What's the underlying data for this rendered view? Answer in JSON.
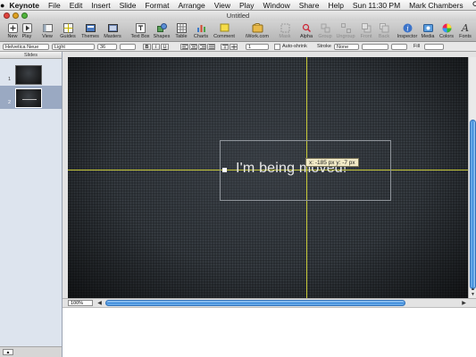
{
  "menubar": {
    "apple": "",
    "app_name": "Keynote",
    "items": [
      "File",
      "Edit",
      "Insert",
      "Slide",
      "Format",
      "Arrange",
      "View",
      "Play",
      "Window",
      "Share",
      "Help"
    ],
    "clock": "Sun 11:30 PM",
    "user": "Mark Chambers"
  },
  "window": {
    "title": "Untitled"
  },
  "toolbar": {
    "items": [
      {
        "label": "New",
        "icon": "plus-icon"
      },
      {
        "label": "Play",
        "icon": "play-icon"
      },
      {
        "label": "View",
        "icon": "view-icon"
      },
      {
        "label": "Guides",
        "icon": "guides-icon"
      },
      {
        "label": "Themes",
        "icon": "themes-icon"
      },
      {
        "label": "Masters",
        "icon": "masters-icon"
      },
      {
        "label": "Text Box",
        "icon": "textbox-icon"
      },
      {
        "label": "Shapes",
        "icon": "shapes-icon"
      },
      {
        "label": "Table",
        "icon": "table-icon"
      },
      {
        "label": "Charts",
        "icon": "charts-icon"
      },
      {
        "label": "Comment",
        "icon": "comment-icon"
      },
      {
        "label": "iWork.com",
        "icon": "iwork-icon"
      },
      {
        "label": "Mask",
        "icon": "mask-icon"
      },
      {
        "label": "Alpha",
        "icon": "alpha-icon"
      },
      {
        "label": "Group",
        "icon": "group-icon"
      },
      {
        "label": "Ungroup",
        "icon": "ungroup-icon"
      },
      {
        "label": "Front",
        "icon": "front-icon"
      },
      {
        "label": "Back",
        "icon": "back-icon"
      },
      {
        "label": "Inspector",
        "icon": "inspector-icon"
      },
      {
        "label": "Media",
        "icon": "media-icon"
      },
      {
        "label": "Colors",
        "icon": "colors-icon"
      },
      {
        "label": "Fonts",
        "icon": "fonts-icon"
      }
    ]
  },
  "formatbar": {
    "font_family": "Helvetica Neue",
    "font_style": "Light",
    "font_size": "36",
    "bold": "B",
    "italic": "I",
    "underline": "U",
    "line_spacing": "1",
    "autoshrink": "Auto-shrink",
    "stroke_label": "Stroke",
    "stroke_value": "None",
    "fill_label": "Fill"
  },
  "navigator": {
    "header": "Slides",
    "slides": [
      {
        "number": "1"
      },
      {
        "number": "2"
      }
    ]
  },
  "slide": {
    "text": "I'm being moved!",
    "tooltip": "x: -185 px   y: -7 px"
  },
  "canvas_bar": {
    "zoom": "100%"
  }
}
